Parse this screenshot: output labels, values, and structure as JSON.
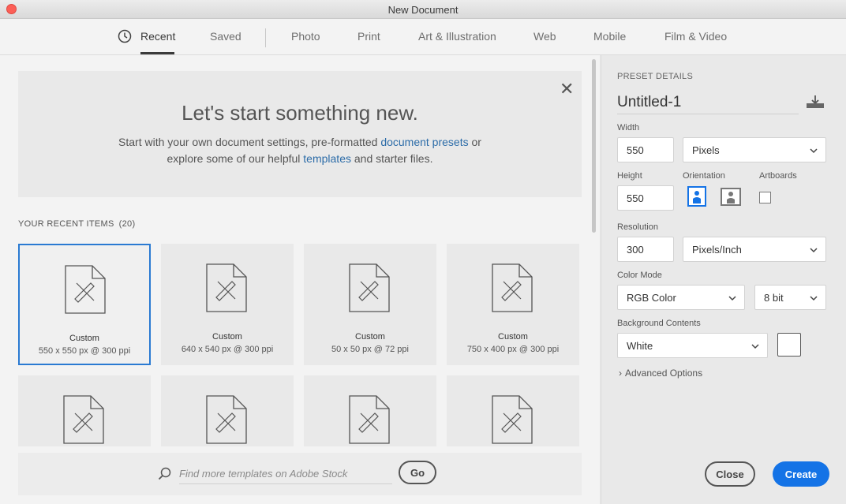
{
  "window": {
    "title": "New Document"
  },
  "tabs": [
    {
      "label": "Recent",
      "active": true
    },
    {
      "label": "Saved"
    },
    {
      "label": "Photo"
    },
    {
      "label": "Print"
    },
    {
      "label": "Art & Illustration"
    },
    {
      "label": "Web"
    },
    {
      "label": "Mobile"
    },
    {
      "label": "Film & Video"
    }
  ],
  "hero": {
    "title": "Let's start something new.",
    "line1_before": "Start with your own document settings, pre-formatted ",
    "line1_link": "document presets",
    "line1_after": " or",
    "line2_before": "explore some of our helpful ",
    "line2_link": "templates",
    "line2_after": " and starter files."
  },
  "recent": {
    "label": "YOUR RECENT ITEMS",
    "count": "(20)",
    "items": [
      {
        "name": "Custom",
        "meta": "550 x 550 px @ 300 ppi",
        "selected": true
      },
      {
        "name": "Custom",
        "meta": "640 x 540 px @ 300 ppi"
      },
      {
        "name": "Custom",
        "meta": "50 x 50 px @ 72 ppi"
      },
      {
        "name": "Custom",
        "meta": "750 x 400 px @ 300 ppi"
      }
    ]
  },
  "stock": {
    "placeholder": "Find more templates on Adobe Stock",
    "go_label": "Go"
  },
  "preset": {
    "header": "PRESET DETAILS",
    "name": "Untitled-1",
    "width_label": "Width",
    "width_value": "550",
    "width_unit": "Pixels",
    "height_label": "Height",
    "height_value": "550",
    "orientation_label": "Orientation",
    "artboards_label": "Artboards",
    "resolution_label": "Resolution",
    "resolution_value": "300",
    "resolution_unit": "Pixels/Inch",
    "color_mode_label": "Color Mode",
    "color_mode": "RGB Color",
    "bit_depth": "8 bit",
    "bg_label": "Background Contents",
    "bg_value": "White",
    "advanced_label": "Advanced Options"
  },
  "footer": {
    "close_label": "Close",
    "create_label": "Create"
  },
  "colors": {
    "accent": "#1473e6",
    "selection": "#2a7ad2",
    "link": "#2c6ca8"
  }
}
